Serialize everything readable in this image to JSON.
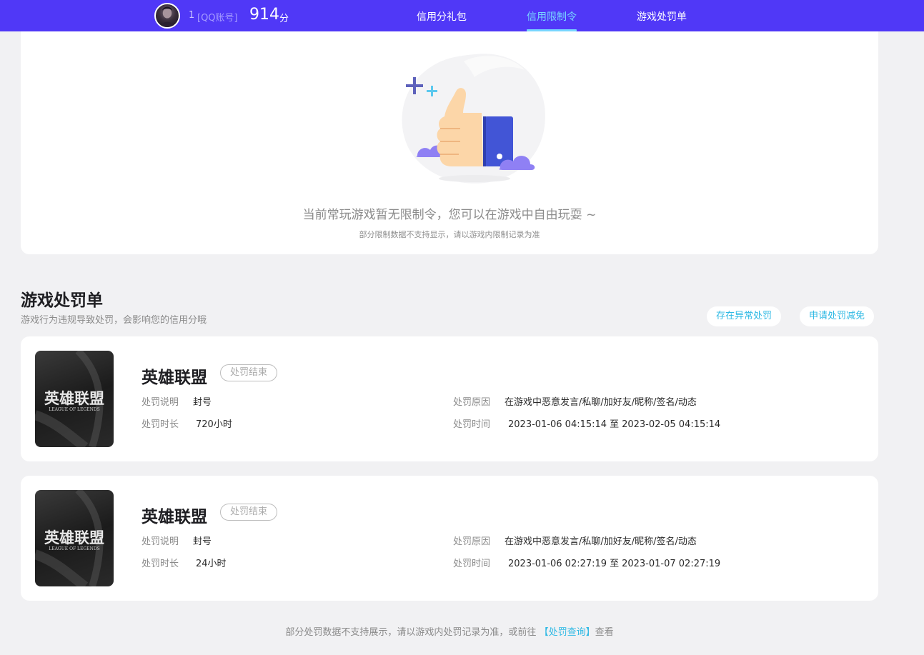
{
  "header": {
    "user_id": "1",
    "account_tag": "[QQ账号]",
    "score": "914",
    "score_unit": "分",
    "tabs": [
      {
        "label": "信用分礼包",
        "active": false
      },
      {
        "label": "信用限制令",
        "active": true
      },
      {
        "label": "游戏处罚单",
        "active": false
      }
    ]
  },
  "restriction": {
    "empty_title": "当前常玩游戏暂无限制令，您可以在游戏中自由玩耍 ~",
    "empty_note": "部分限制数据不支持显示，请以游戏内限制记录为准"
  },
  "penalties": {
    "title": "游戏处罚单",
    "subtitle": "游戏行为违规导致处罚，会影响您的信用分哦",
    "buttons": {
      "report_abnormal": "存在异常处罚",
      "apply_reduction": "申请处罚减免"
    },
    "labels": {
      "description": "处罚说明",
      "duration": "处罚时长",
      "reason": "处罚原因",
      "time": "处罚时间",
      "to": "至"
    },
    "cover_text": {
      "cn": "英雄联盟",
      "en": "LEAGUE OF LEGENDS"
    },
    "items": [
      {
        "game": "英雄联盟",
        "status": "处罚结束",
        "description": "封号",
        "duration": "720小时",
        "reason": "在游戏中恶意发言/私聊/加好友/昵称/签名/动态",
        "start": "2023-01-06 04:15:14",
        "end": "2023-02-05 04:15:14"
      },
      {
        "game": "英雄联盟",
        "status": "处罚结束",
        "description": "封号",
        "duration": "24小时",
        "reason": "在游戏中恶意发言/私聊/加好友/昵称/签名/动态",
        "start": "2023-01-06 02:27:19",
        "end": "2023-01-07 02:27:19"
      }
    ]
  },
  "footer": {
    "text": "部分处罚数据不支持展示，请以游戏内处罚记录为准，或前往",
    "link": "【处罚查询】",
    "suffix": "查看"
  },
  "colors": {
    "topbar": "#5038f7",
    "accent": "#2fb9e4",
    "active_tab": "#78d7ff"
  }
}
